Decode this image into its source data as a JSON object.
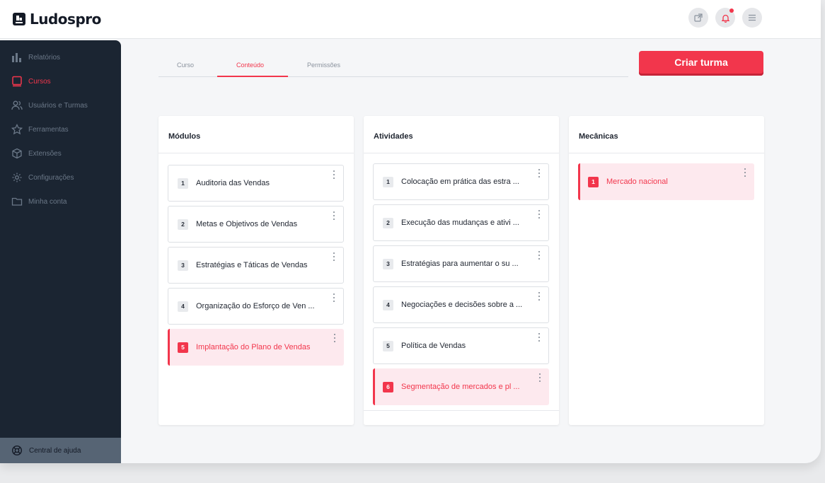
{
  "brand": {
    "name": "Ludospro"
  },
  "header": {
    "actions": [
      {
        "name": "external-link-icon"
      },
      {
        "name": "bell-icon",
        "has_notification": true
      },
      {
        "name": "menu-icon"
      }
    ]
  },
  "sidebar": {
    "items": [
      {
        "label": "Relatórios",
        "icon": "bar-chart-icon",
        "active": false
      },
      {
        "label": "Cursos",
        "icon": "course-icon",
        "active": true
      },
      {
        "label": "Usuários e Turmas",
        "icon": "users-icon",
        "active": false
      },
      {
        "label": "Ferramentas",
        "icon": "star-icon",
        "active": false
      },
      {
        "label": "Extensões",
        "icon": "package-icon",
        "active": false
      },
      {
        "label": "Configurações",
        "icon": "settings-icon",
        "active": false
      },
      {
        "label": "Minha conta",
        "icon": "folder-icon",
        "active": false
      }
    ],
    "help_label": "Central de ajuda"
  },
  "tabs": [
    {
      "label": "Curso",
      "active": false
    },
    {
      "label": "Conteúdo",
      "active": true
    },
    {
      "label": "Permissões",
      "active": false
    }
  ],
  "create_button": {
    "label": "Criar turma"
  },
  "panels": {
    "modulos": {
      "title": "Módulos",
      "items": [
        {
          "num": "1",
          "label": "Auditoria das Vendas"
        },
        {
          "num": "2",
          "label": "Metas e Objetivos de Vendas"
        },
        {
          "num": "3",
          "label": "Estratégias e Táticas de Vendas"
        },
        {
          "num": "4",
          "label": "Organização do Esforço de Ven ..."
        },
        {
          "num": "5",
          "label": "Implantação do Plano de Vendas",
          "active": true
        }
      ]
    },
    "atividades": {
      "title": "Atividades",
      "items": [
        {
          "num": "1",
          "label": "Colocação em prática das estra ..."
        },
        {
          "num": "2",
          "label": "Execução das mudanças e ativi ..."
        },
        {
          "num": "3",
          "label": "Estratégias para aumentar o su ..."
        },
        {
          "num": "4",
          "label": "Negociações e decisões sobre a ..."
        },
        {
          "num": "5",
          "label": "Política de Vendas"
        },
        {
          "num": "6",
          "label": "Segmentação de mercados e pl ...",
          "active": true
        }
      ]
    },
    "mecanicas": {
      "title": "Mecânicas",
      "items": [
        {
          "num": "1",
          "label": "Mercado nacional",
          "active": true
        }
      ]
    }
  },
  "colors": {
    "accent": "#f2364c",
    "sidebar": "#1b2532",
    "active_card_bg": "#fde9ee"
  }
}
